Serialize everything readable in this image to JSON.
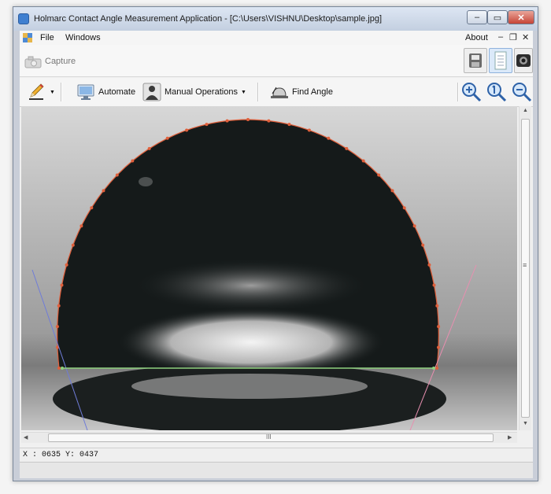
{
  "window": {
    "title": "Holmarc Contact Angle Measurement Application - [C:\\Users\\VISHNU\\Desktop\\sample.jpg]",
    "controls": {
      "minimize": "–",
      "maximize": "▭",
      "close": "✕"
    }
  },
  "menubar": {
    "items": [
      "File",
      "Windows"
    ],
    "right_items": [
      "About"
    ],
    "mdi_controls": {
      "minimize": "–",
      "restore": "❐",
      "close": "✕"
    }
  },
  "capture": {
    "label": "Capture"
  },
  "toolbar": {
    "automate_label": "Automate",
    "manual_label": "Manual Operations",
    "find_angle_label": "Find Angle"
  },
  "icons": {
    "app": "app-icon",
    "capture": "camera-icon",
    "edit": "pencil-icon",
    "automate": "monitor-icon",
    "manual": "person-icon",
    "find_angle": "angle-icon",
    "zoom_in": "zoom-in-icon",
    "zoom_reset": "zoom-actual-icon",
    "zoom_out": "zoom-out-icon"
  },
  "colors": {
    "contour": "#e0603c",
    "baseline": "#8fd27f",
    "tangent_left": "#6f7cd8",
    "tangent_right": "#e88fb0",
    "droplet": "#151a1a"
  },
  "statusbar": {
    "x_label": "X :",
    "x_value": "0635",
    "y_label": "Y:",
    "y_value": "0437"
  },
  "scroll": {
    "h_grip": "III",
    "v_grip": "≡"
  }
}
